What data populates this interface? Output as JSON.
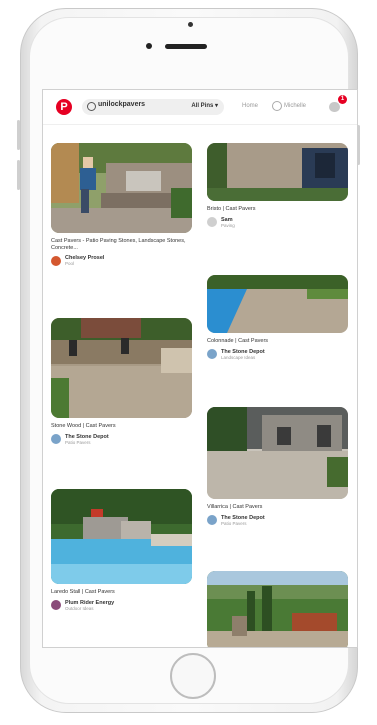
{
  "topbar": {
    "logo": "P",
    "search_text": "unilockpavers",
    "filter_label": "All Pins ▾",
    "nav_home": "Home",
    "nav_user": "Michelle",
    "notification_count": "1"
  },
  "pins": [
    {
      "title": "Cast Pavers - Patio Paving Stones, Landscape Stones, Concrete...",
      "user": "Chelsey Prosel",
      "sub": "Pool",
      "avatar_color": "#d4582f"
    },
    {
      "title": "Bristo | Cast Pavers",
      "user": "Sam",
      "sub": "Paving",
      "avatar_color": "#cfcfcf"
    },
    {
      "title": "Colonnade | Cast Pavers",
      "user": "The Stone Depot",
      "sub": "Landscape Ideas",
      "avatar_color": "#7aa3c9"
    },
    {
      "title": "Stone Wood | Cast Pavers",
      "user": "The Stone Depot",
      "sub": "Patio Pavers",
      "avatar_color": "#7aa3c9"
    },
    {
      "title": "Villarrica | Cast Pavers",
      "user": "The Stone Depot",
      "sub": "Patio Pavers",
      "avatar_color": "#7aa3c9"
    },
    {
      "title": "Laredo Stall | Cast Pavers",
      "user": "Plum Rider Energy",
      "sub": "Outdoor Ideas",
      "avatar_color": "#8a4b7a"
    }
  ]
}
